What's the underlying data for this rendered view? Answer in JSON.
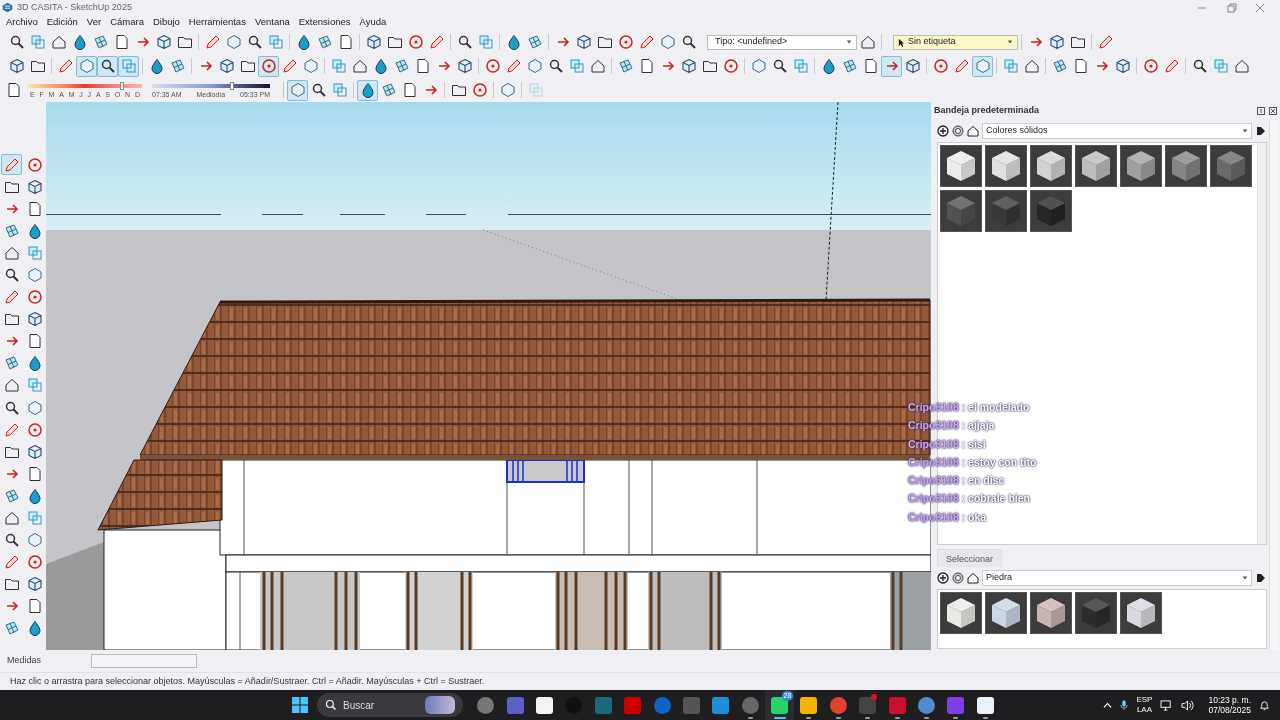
{
  "window": {
    "title": "3D CASITA - SketchUp 2025"
  },
  "menu": [
    "Archivo",
    "Edición",
    "Ver",
    "Cámara",
    "Dibujo",
    "Herramientas",
    "Ventana",
    "Extensiones",
    "Ayuda"
  ],
  "toolbar_row_1": [
    {
      "kind": "button",
      "pressed": false
    },
    {
      "kind": "button",
      "pressed": false
    },
    {
      "kind": "button",
      "pressed": false
    },
    {
      "kind": "button",
      "pressed": false
    },
    {
      "kind": "button",
      "pressed": false
    },
    {
      "kind": "button",
      "pressed": false
    },
    {
      "kind": "button",
      "pressed": false
    },
    {
      "kind": "button",
      "pressed": false
    },
    {
      "kind": "button",
      "pressed": false
    },
    {
      "kind": "separator"
    },
    {
      "kind": "button",
      "pressed": false
    },
    {
      "kind": "button",
      "pressed": false
    },
    {
      "kind": "button",
      "pressed": false
    },
    {
      "kind": "button",
      "pressed": false
    },
    {
      "kind": "separator"
    },
    {
      "kind": "button",
      "pressed": false
    },
    {
      "kind": "button",
      "pressed": false
    },
    {
      "kind": "button",
      "pressed": false
    },
    {
      "kind": "separator"
    },
    {
      "kind": "button",
      "pressed": false
    },
    {
      "kind": "button",
      "pressed": false
    },
    {
      "kind": "button",
      "pressed": false
    },
    {
      "kind": "button",
      "pressed": false
    },
    {
      "kind": "separator"
    },
    {
      "kind": "button",
      "pressed": false
    },
    {
      "kind": "button",
      "pressed": false
    },
    {
      "kind": "separator"
    },
    {
      "kind": "button",
      "pressed": false
    },
    {
      "kind": "button",
      "pressed": false
    },
    {
      "kind": "separator"
    },
    {
      "kind": "button",
      "pressed": false
    },
    {
      "kind": "button",
      "pressed": false
    },
    {
      "kind": "button",
      "pressed": false
    },
    {
      "kind": "button",
      "pressed": false
    },
    {
      "kind": "button",
      "pressed": false
    },
    {
      "kind": "button",
      "pressed": false
    },
    {
      "kind": "button",
      "pressed": false
    },
    {
      "kind": "dropdown",
      "value": "Tipo: <undefined>"
    },
    {
      "kind": "button",
      "pressed": false
    },
    {
      "kind": "separator"
    },
    {
      "kind": "tag_dropdown",
      "value": "Sin etiqueta"
    },
    {
      "kind": "separator"
    },
    {
      "kind": "button",
      "pressed": false
    },
    {
      "kind": "button",
      "pressed": false
    },
    {
      "kind": "button",
      "pressed": false
    },
    {
      "kind": "separator"
    },
    {
      "kind": "button",
      "pressed": false
    }
  ],
  "toolbar_row_2": [
    {
      "kind": "button",
      "pressed": false
    },
    {
      "kind": "button",
      "pressed": false
    },
    {
      "kind": "separator"
    },
    {
      "kind": "button",
      "pressed": false
    },
    {
      "kind": "button",
      "pressed": true
    },
    {
      "kind": "button",
      "pressed": true
    },
    {
      "kind": "button",
      "pressed": true
    },
    {
      "kind": "separator"
    },
    {
      "kind": "button",
      "pressed": false
    },
    {
      "kind": "button",
      "pressed": false
    },
    {
      "kind": "separator"
    },
    {
      "kind": "button",
      "pressed": false
    },
    {
      "kind": "button",
      "pressed": false
    },
    {
      "kind": "button",
      "pressed": false
    },
    {
      "kind": "button",
      "pressed": true
    },
    {
      "kind": "button",
      "pressed": false
    },
    {
      "kind": "button",
      "pressed": false
    },
    {
      "kind": "separator"
    },
    {
      "kind": "button",
      "pressed": false
    },
    {
      "kind": "button",
      "pressed": false
    },
    {
      "kind": "button",
      "pressed": false
    },
    {
      "kind": "button",
      "pressed": false
    },
    {
      "kind": "button",
      "pressed": false
    },
    {
      "kind": "button",
      "pressed": false
    },
    {
      "kind": "button",
      "pressed": false
    },
    {
      "kind": "separator"
    },
    {
      "kind": "button",
      "pressed": false
    },
    {
      "kind": "button",
      "pressed": false
    },
    {
      "kind": "button",
      "pressed": false
    },
    {
      "kind": "button",
      "pressed": false
    },
    {
      "kind": "button",
      "pressed": false
    },
    {
      "kind": "button",
      "pressed": false
    },
    {
      "kind": "separator"
    },
    {
      "kind": "button",
      "pressed": false
    },
    {
      "kind": "button",
      "pressed": false
    },
    {
      "kind": "button",
      "pressed": false
    },
    {
      "kind": "button",
      "pressed": false
    },
    {
      "kind": "button",
      "pressed": false
    },
    {
      "kind": "button",
      "pressed": false
    },
    {
      "kind": "separator"
    },
    {
      "kind": "button",
      "pressed": false
    },
    {
      "kind": "button",
      "pressed": false
    },
    {
      "kind": "button",
      "pressed": false
    },
    {
      "kind": "separator"
    },
    {
      "kind": "button",
      "pressed": false
    },
    {
      "kind": "button",
      "pressed": false
    },
    {
      "kind": "button",
      "pressed": false
    },
    {
      "kind": "button",
      "pressed": true
    },
    {
      "kind": "button",
      "pressed": false
    },
    {
      "kind": "separator"
    },
    {
      "kind": "button",
      "pressed": false
    },
    {
      "kind": "button",
      "pressed": false
    },
    {
      "kind": "button",
      "pressed": true
    },
    {
      "kind": "separator"
    },
    {
      "kind": "button",
      "pressed": false
    },
    {
      "kind": "button",
      "pressed": false
    },
    {
      "kind": "separator"
    },
    {
      "kind": "button",
      "pressed": false
    },
    {
      "kind": "button",
      "pressed": false
    },
    {
      "kind": "button",
      "pressed": false
    },
    {
      "kind": "button",
      "pressed": false
    },
    {
      "kind": "separator"
    },
    {
      "kind": "button",
      "pressed": false
    },
    {
      "kind": "button",
      "pressed": false
    },
    {
      "kind": "separator"
    },
    {
      "kind": "button",
      "pressed": false
    },
    {
      "kind": "button",
      "pressed": false
    },
    {
      "kind": "button",
      "pressed": false
    }
  ],
  "shadows": {
    "months": [
      "E",
      "F",
      "M",
      "A",
      "M",
      "J",
      "J",
      "A",
      "S",
      "O",
      "N",
      "D"
    ],
    "date_slider": {
      "level": 0.84
    },
    "time_slider": {
      "level": 0.68
    },
    "time_start": "07:35 AM",
    "time_middle": "Mediodía",
    "time_end": "05:33 PM"
  },
  "toolbar_row_3": [
    {
      "kind": "separator"
    },
    {
      "kind": "button",
      "pressed": true,
      "disabled": false
    },
    {
      "kind": "button",
      "pressed": false,
      "disabled": false
    },
    {
      "kind": "button",
      "pressed": false,
      "disabled": false
    },
    {
      "kind": "separator"
    },
    {
      "kind": "button",
      "pressed": true,
      "disabled": false
    },
    {
      "kind": "button",
      "pressed": false,
      "disabled": false
    },
    {
      "kind": "button",
      "pressed": false,
      "disabled": false
    },
    {
      "kind": "button",
      "pressed": false,
      "disabled": false
    },
    {
      "kind": "separator"
    },
    {
      "kind": "button",
      "pressed": false,
      "disabled": false
    },
    {
      "kind": "button",
      "pressed": false,
      "disabled": false
    },
    {
      "kind": "separator"
    },
    {
      "kind": "button",
      "pressed": false,
      "disabled": false
    },
    {
      "kind": "separator"
    },
    {
      "kind": "button",
      "pressed": false,
      "disabled": true
    }
  ],
  "left_toolbar": [
    {
      "pressed": true
    },
    {
      "pressed": false
    },
    {
      "pressed": false
    },
    {
      "pressed": false
    },
    {
      "pressed": false
    },
    {
      "pressed": false
    },
    {
      "pressed": false
    },
    {
      "pressed": false
    },
    {
      "pressed": false
    },
    {
      "pressed": false
    },
    {
      "pressed": false
    },
    {
      "pressed": false
    },
    {
      "pressed": false
    },
    {
      "pressed": false
    },
    {
      "pressed": false
    },
    {
      "pressed": false
    },
    {
      "pressed": false
    },
    {
      "pressed": false
    },
    {
      "pressed": false
    },
    {
      "pressed": false
    },
    {
      "pressed": false
    },
    {
      "pressed": false
    },
    {
      "pressed": false
    },
    {
      "pressed": false
    },
    {
      "pressed": false
    },
    {
      "pressed": false
    },
    {
      "pressed": false
    },
    {
      "pressed": false
    },
    {
      "pressed": false
    },
    {
      "pressed": false
    },
    {
      "pressed": false
    },
    {
      "pressed": false
    },
    {
      "pressed": false
    },
    {
      "pressed": false
    },
    {
      "pressed": false
    },
    {
      "pressed": false
    },
    {
      "pressed": false
    },
    {
      "pressed": false
    },
    {
      "pressed": false
    },
    {
      "pressed": false
    },
    {
      "pressed": false
    },
    {
      "pressed": false
    },
    {
      "pressed": false
    },
    {
      "pressed": false
    }
  ],
  "chat": [
    {
      "user": "Cripo3108",
      "message": ": el modelado"
    },
    {
      "user": "Cripo3108",
      "message": ": ajjaja"
    },
    {
      "user": "Cripo3108",
      "message": ": sisi"
    },
    {
      "user": "Cripo3108",
      "message": ": estoy con tito"
    },
    {
      "user": "Cripo3108",
      "message": ": en disc"
    },
    {
      "user": "Cripo3108",
      "message": ": cobrale bien"
    },
    {
      "user": "Cripo3108",
      "message": ": oka"
    }
  ],
  "tray": {
    "title": "Bandeja predeterminada",
    "materials": {
      "library": "Colores sólidos",
      "swatches": [
        {
          "color": "#ececec"
        },
        {
          "color": "#e0e0e0"
        },
        {
          "color": "#d2d2d2"
        },
        {
          "color": "#bdbdbd"
        },
        {
          "color": "#a0a0a0"
        },
        {
          "color": "#858585"
        },
        {
          "color": "#6a6a6a"
        },
        {
          "color": "#525252"
        },
        {
          "color": "#383838"
        },
        {
          "color": "#262626"
        }
      ]
    },
    "select_tab": "Seleccionar",
    "select": {
      "library": "Piedra",
      "swatches": [
        {
          "color": "#ebe9e4"
        },
        {
          "color": "#c9d6e6"
        },
        {
          "color": "#c8b4b1"
        },
        {
          "color": "#2d2d2d"
        },
        {
          "color": "#d8d8e0"
        }
      ]
    }
  },
  "measurements": {
    "label": "Medidas"
  },
  "status_bar": "Haz clic o arrastra para seleccionar objetos. Mayúsculas = Añadir/Sustraer. Ctrl = Añadir. Mayúsculas + Ctrl = Sustraer.",
  "taskbar": {
    "search": {
      "placeholder": "Buscar"
    },
    "apps": [
      {
        "running": false,
        "active": false,
        "alert": false
      },
      {
        "running": false,
        "active": false,
        "alert": false
      },
      {
        "running": false,
        "active": false,
        "alert": false
      },
      {
        "running": false,
        "active": false,
        "alert": false
      },
      {
        "running": false,
        "active": false,
        "alert": false
      },
      {
        "running": false,
        "active": false,
        "alert": false
      },
      {
        "running": false,
        "active": false,
        "alert": false
      },
      {
        "running": false,
        "active": false,
        "alert": false
      },
      {
        "running": false,
        "active": false,
        "alert": false
      },
      {
        "running": true,
        "active": false,
        "alert": false
      },
      {
        "running": true,
        "active": true,
        "alert": false,
        "badge": "28"
      },
      {
        "running": true,
        "active": false,
        "alert": false
      },
      {
        "running": true,
        "active": false,
        "alert": false
      },
      {
        "running": true,
        "active": false,
        "alert": true
      },
      {
        "running": true,
        "active": false,
        "alert": false
      },
      {
        "running": true,
        "active": false,
        "alert": false
      },
      {
        "running": true,
        "active": false,
        "alert": false
      },
      {
        "running": true,
        "active": false,
        "alert": false
      }
    ],
    "language": "ESP",
    "region": "LAA",
    "time": "10:23 p. m.",
    "date": "07/08/2025"
  }
}
